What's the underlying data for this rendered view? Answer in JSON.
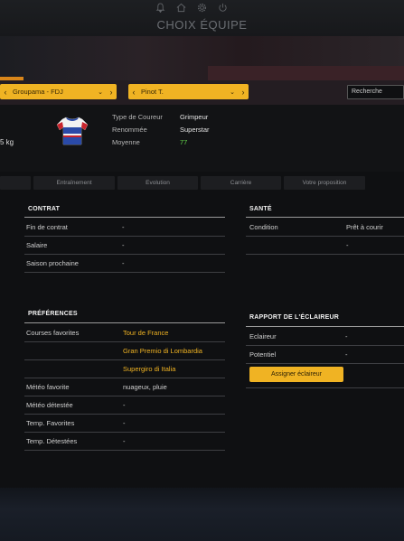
{
  "header": {
    "title": "CHOIX ÉQUIPE",
    "icons": [
      "bell-icon",
      "home-icon",
      "gear-icon",
      "power-icon"
    ]
  },
  "selectors": {
    "team": "Groupama - FDJ",
    "rider": "Pinot T.",
    "search_value": "Recherche"
  },
  "rider_info": {
    "weight_fragment": "5 kg",
    "type_label": "Type de Coureur",
    "type_value": "Grimpeur",
    "fame_label": "Renommée",
    "fame_value": "Superstar",
    "avg_label": "Moyenne",
    "avg_value": "77"
  },
  "tabs": [
    "",
    "Entraînement",
    "Evolution",
    "Carrière",
    "Votre proposition"
  ],
  "contract": {
    "title": "CONTRAT",
    "rows": [
      {
        "label": "Fin de contrat",
        "value": "-"
      },
      {
        "label": "Salaire",
        "value": "-"
      },
      {
        "label": "Saison prochaine",
        "value": "-"
      }
    ]
  },
  "health": {
    "title": "SANTÉ",
    "rows": [
      {
        "label": "Condition",
        "value": "Prêt à courir"
      },
      {
        "label": "",
        "value": "-"
      }
    ]
  },
  "preferences": {
    "title": "PRÉFÉRENCES",
    "fav_races_label": "Courses favorites",
    "fav_races": [
      "Tour de France",
      "Gran Premio di Lombardia",
      "Supergiro di Italia"
    ],
    "weather_fav_label": "Météo favorite",
    "weather_fav": "nuageux, pluie",
    "weather_hated_label": "Météo détestée",
    "weather_hated": "-",
    "temp_fav_label": "Temp. Favorites",
    "temp_fav": "-",
    "temp_hated_label": "Temp. Détestées",
    "temp_hated": "-"
  },
  "scout": {
    "title": "RAPPORT DE L'ÉCLAIREUR",
    "rows": [
      {
        "label": "Eclaireur",
        "value": "-"
      },
      {
        "label": "Potentiel",
        "value": "-"
      }
    ],
    "assign_button": "Assigner éclaireur"
  },
  "colors": {
    "accent": "#f0b323",
    "green": "#62d34a",
    "background": "#0f1012"
  }
}
